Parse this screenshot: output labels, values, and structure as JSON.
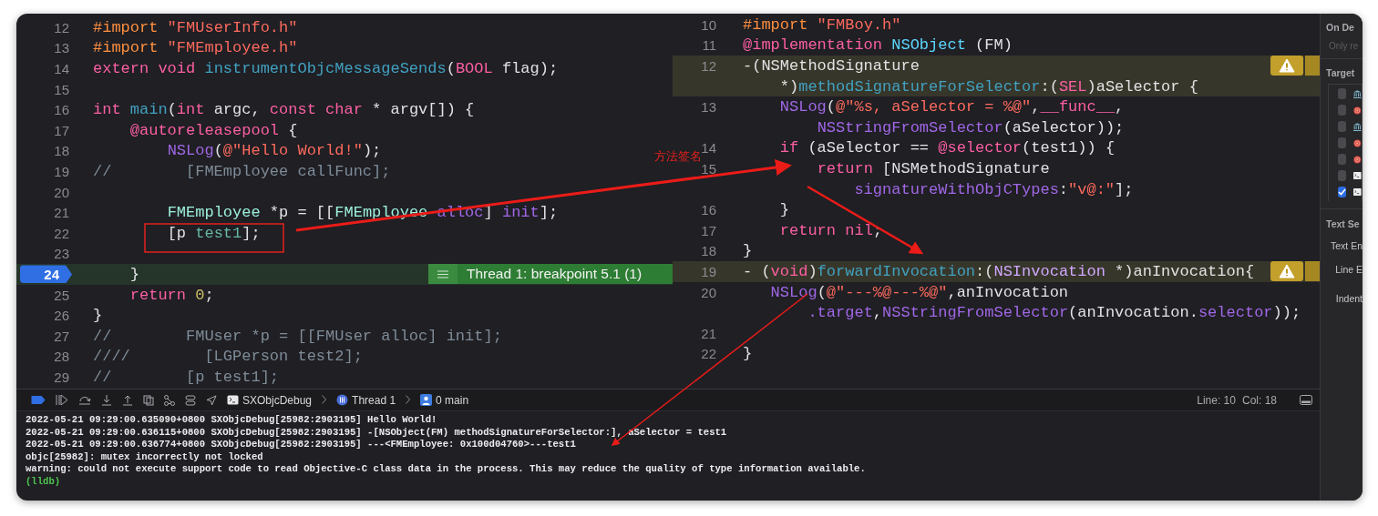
{
  "left_editor": {
    "breakpoint_banner": "Thread 1: breakpoint 5.1 (1)",
    "lines": [
      {
        "number": "12",
        "kind": "code",
        "rows": [
          {
            "tokens": [
              {
                "kind": "pre",
                "text": "#import"
              },
              {
                "kind": "str",
                "text": " \"FMUserInfo.h\""
              }
            ]
          }
        ]
      },
      {
        "number": "13",
        "kind": "code",
        "rows": [
          {
            "tokens": [
              {
                "kind": "pre",
                "text": "#import"
              },
              {
                "kind": "str",
                "text": " \"FMEmployee.h\""
              }
            ]
          }
        ]
      },
      {
        "number": "14",
        "kind": "code",
        "rows": [
          {
            "tokens": [
              {
                "kind": "kw",
                "text": "extern"
              },
              {
                "kind": "kw",
                "text": " void"
              },
              {
                "kind": "decl",
                "text": " instrumentObjcMessageSends"
              },
              {
                "kind": "tx",
                "text": "("
              },
              {
                "kind": "kw",
                "text": "BOOL"
              },
              {
                "kind": "tx",
                "text": " flag);"
              }
            ]
          }
        ]
      },
      {
        "number": "15",
        "kind": "code",
        "rows": [
          {
            "tokens": []
          }
        ]
      },
      {
        "number": "16",
        "kind": "code",
        "rows": [
          {
            "tokens": [
              {
                "kind": "kw",
                "text": "int"
              },
              {
                "kind": "decl",
                "text": " main"
              },
              {
                "kind": "tx",
                "text": "("
              },
              {
                "kind": "kw",
                "text": "int"
              },
              {
                "kind": "tx",
                "text": " argc, "
              },
              {
                "kind": "kw",
                "text": "const"
              },
              {
                "kind": "kw",
                "text": " char"
              },
              {
                "kind": "tx",
                "text": " * argv[]) {"
              }
            ]
          }
        ]
      },
      {
        "number": "17",
        "kind": "code",
        "rows": [
          {
            "tokens": [
              {
                "kind": "kw",
                "text": "    @autoreleasepool"
              },
              {
                "kind": "tx",
                "text": " {"
              }
            ]
          }
        ]
      },
      {
        "number": "18",
        "kind": "code",
        "rows": [
          {
            "tokens": [
              {
                "kind": "fn",
                "text": "        NSLog"
              },
              {
                "kind": "tx",
                "text": "("
              },
              {
                "kind": "str",
                "text": "@\"Hello World!\""
              },
              {
                "kind": "tx",
                "text": ");"
              }
            ]
          }
        ]
      },
      {
        "number": "19",
        "kind": "code",
        "rows": [
          {
            "tokens": [
              {
                "kind": "cm",
                "text": "//        [FMEmployee callFunc];"
              }
            ]
          }
        ]
      },
      {
        "number": "20",
        "kind": "code",
        "rows": [
          {
            "tokens": []
          }
        ]
      },
      {
        "number": "21",
        "kind": "code",
        "rows": [
          {
            "tokens": [
              {
                "kind": "cls",
                "text": "        FMEmployee"
              },
              {
                "kind": "tx",
                "text": " *p = [["
              },
              {
                "kind": "cls",
                "text": "FMEmployee"
              },
              {
                "kind": "fn",
                "text": " alloc"
              },
              {
                "kind": "tx",
                "text": "] "
              },
              {
                "kind": "fn",
                "text": "init"
              },
              {
                "kind": "tx",
                "text": "];"
              }
            ]
          }
        ]
      },
      {
        "number": "22",
        "kind": "code",
        "rows": [
          {
            "tokens": [
              {
                "kind": "tx",
                "text": "        [p "
              },
              {
                "kind": "proj",
                "text": "test1"
              },
              {
                "kind": "tx",
                "text": "];"
              }
            ]
          }
        ]
      },
      {
        "number": "23",
        "kind": "code",
        "rows": [
          {
            "tokens": []
          }
        ]
      },
      {
        "number": "24",
        "kind": "breakpoint",
        "rows": [
          {
            "tokens": [
              {
                "kind": "tx",
                "text": "    }"
              }
            ]
          }
        ]
      },
      {
        "number": "25",
        "kind": "code",
        "rows": [
          {
            "tokens": [
              {
                "kind": "kw",
                "text": "    return"
              },
              {
                "kind": "num",
                "text": " 0"
              },
              {
                "kind": "tx",
                "text": ";"
              }
            ]
          }
        ]
      },
      {
        "number": "26",
        "kind": "code",
        "rows": [
          {
            "tokens": [
              {
                "kind": "tx",
                "text": "}"
              }
            ]
          }
        ]
      },
      {
        "number": "27",
        "kind": "code",
        "rows": [
          {
            "tokens": [
              {
                "kind": "cm",
                "text": "//        FMUser *p = [[FMUser alloc] init];"
              }
            ]
          }
        ]
      },
      {
        "number": "28",
        "kind": "code",
        "rows": [
          {
            "tokens": [
              {
                "kind": "cm",
                "text": "////        [LGPerson test2];"
              }
            ]
          }
        ]
      },
      {
        "number": "29",
        "kind": "code",
        "rows": [
          {
            "tokens": [
              {
                "kind": "cm",
                "text": "//        [p test1];"
              }
            ]
          }
        ]
      }
    ]
  },
  "right_editor": {
    "lines": [
      {
        "number": "10",
        "kind": "code",
        "rows": [
          {
            "tokens": [
              {
                "kind": "pre",
                "text": "#import"
              },
              {
                "kind": "str",
                "text": " \"FMBoy.h\""
              }
            ]
          }
        ]
      },
      {
        "number": "11",
        "kind": "code",
        "rows": [
          {
            "tokens": [
              {
                "kind": "kw",
                "text": "@implementation"
              },
              {
                "kind": "sys",
                "text": " NSObject"
              },
              {
                "kind": "tx",
                "text": " (FM)"
              }
            ]
          }
        ]
      },
      {
        "number": "12",
        "kind": "warning",
        "rows": [
          {
            "tokens": [
              {
                "kind": "tx",
                "text": "-(NSMethodSignature"
              }
            ]
          },
          {
            "tokens": [
              {
                "kind": "tx",
                "text": "    *)"
              },
              {
                "kind": "decl",
                "text": "methodSignatureForSelector"
              },
              {
                "kind": "tx",
                "text": ":("
              },
              {
                "kind": "kw",
                "text": "SEL"
              },
              {
                "kind": "tx",
                "text": ")aSelector {"
              }
            ]
          }
        ]
      },
      {
        "number": "13",
        "kind": "code",
        "rows": [
          {
            "tokens": [
              {
                "kind": "fn",
                "text": "    NSLog"
              },
              {
                "kind": "tx",
                "text": "("
              },
              {
                "kind": "str",
                "text": "@\"%s, aSelector = %@\""
              },
              {
                "kind": "tx",
                "text": ","
              },
              {
                "kind": "kw",
                "text": "__func__"
              },
              {
                "kind": "tx",
                "text": ","
              }
            ]
          },
          {
            "tokens": [
              {
                "kind": "fn",
                "text": "        NSStringFromSelector"
              },
              {
                "kind": "tx",
                "text": "(aSelector));"
              }
            ]
          }
        ]
      },
      {
        "number": "14",
        "kind": "code",
        "rows": [
          {
            "tokens": [
              {
                "kind": "kw",
                "text": "    if"
              },
              {
                "kind": "tx",
                "text": " (aSelector == "
              },
              {
                "kind": "kw",
                "text": "@selector"
              },
              {
                "kind": "tx",
                "text": "(test1)) {"
              }
            ]
          }
        ]
      },
      {
        "number": "15",
        "kind": "code",
        "rows": [
          {
            "tokens": [
              {
                "kind": "kw",
                "text": "        return"
              },
              {
                "kind": "tx",
                "text": " [NSMethodSignature"
              }
            ]
          },
          {
            "tokens": [
              {
                "kind": "fn",
                "text": "            signatureWithObjCTypes"
              },
              {
                "kind": "tx",
                "text": ":"
              },
              {
                "kind": "str",
                "text": "\"v@:\""
              },
              {
                "kind": "tx",
                "text": "];"
              }
            ]
          }
        ]
      },
      {
        "number": "16",
        "kind": "code",
        "rows": [
          {
            "tokens": [
              {
                "kind": "tx",
                "text": "    }"
              }
            ]
          }
        ]
      },
      {
        "number": "17",
        "kind": "code",
        "rows": [
          {
            "tokens": [
              {
                "kind": "kw",
                "text": "    return"
              },
              {
                "kind": "kw",
                "text": " nil"
              },
              {
                "kind": "tx",
                "text": ";"
              }
            ]
          }
        ]
      },
      {
        "number": "18",
        "kind": "code",
        "rows": [
          {
            "tokens": [
              {
                "kind": "tx",
                "text": "}"
              }
            ]
          }
        ]
      },
      {
        "number": "19",
        "kind": "warning",
        "rows": [
          {
            "tokens": [
              {
                "kind": "tx",
                "text": "- ("
              },
              {
                "kind": "kw",
                "text": "void"
              },
              {
                "kind": "tx",
                "text": ")"
              },
              {
                "kind": "decl",
                "text": "forwardInvocation"
              },
              {
                "kind": "tx",
                "text": ":("
              },
              {
                "kind": "typ",
                "text": "NSInvocation"
              },
              {
                "kind": "tx",
                "text": " *)anInvocation{"
              }
            ]
          }
        ]
      },
      {
        "number": "20",
        "kind": "code",
        "rows": [
          {
            "tokens": [
              {
                "kind": "fn",
                "text": "   NSLog"
              },
              {
                "kind": "tx",
                "text": "("
              },
              {
                "kind": "str",
                "text": "@\"---%@---%@\""
              },
              {
                "kind": "tx",
                "text": ",anInvocation"
              }
            ]
          },
          {
            "tokens": [
              {
                "kind": "fn",
                "text": "       .target"
              },
              {
                "kind": "tx",
                "text": ","
              },
              {
                "kind": "fn",
                "text": "NSStringFromSelector"
              },
              {
                "kind": "tx",
                "text": "(anInvocation."
              },
              {
                "kind": "fn",
                "text": "selector"
              },
              {
                "kind": "tx",
                "text": "));"
              }
            ]
          }
        ]
      },
      {
        "number": "21",
        "kind": "code",
        "rows": [
          {
            "tokens": []
          }
        ]
      },
      {
        "number": "22",
        "kind": "code",
        "rows": [
          {
            "tokens": [
              {
                "kind": "tx",
                "text": "}"
              }
            ]
          }
        ]
      }
    ]
  },
  "annotation_label": "方法签名",
  "debug_bar": {
    "breakpoints_active": true,
    "breadcrumbs": [
      {
        "kind": "app",
        "text": "SXObjcDebug"
      },
      {
        "kind": "thread",
        "text": "Thread 1"
      },
      {
        "kind": "frame",
        "text": "0 main"
      }
    ],
    "line": "Line: 10",
    "column": "Col: 18"
  },
  "console": {
    "lines": [
      {
        "kind": "output",
        "text": "2022-05-21 09:29:00.635090+0800 SXObjcDebug[25982:2903195] Hello World!"
      },
      {
        "kind": "output",
        "text": "2022-05-21 09:29:00.636115+0800 SXObjcDebug[25982:2903195] -[NSObject(FM) methodSignatureForSelector:], aSelector = test1"
      },
      {
        "kind": "output",
        "text": "2022-05-21 09:29:00.636774+0800 SXObjcDebug[25982:2903195] ---<FMEmployee: 0x100d04760>---test1"
      },
      {
        "kind": "output",
        "text": "objc[25982]: mutex incorrectly not locked"
      },
      {
        "kind": "output",
        "text": "warning: could not execute support code to read Objective-C class data in the process. This may reduce the quality of type information available."
      },
      {
        "kind": "prompt",
        "text": "(lldb)"
      }
    ]
  },
  "inspector": {
    "on_demand_title": "On De",
    "on_demand_hint": "Only re",
    "target_title": "Target",
    "targets": [
      {
        "kind": "library",
        "checked": false
      },
      {
        "kind": "target",
        "checked": false
      },
      {
        "kind": "library",
        "checked": false
      },
      {
        "kind": "target",
        "checked": false
      },
      {
        "kind": "target",
        "checked": false
      },
      {
        "kind": "tool",
        "checked": false
      },
      {
        "kind": "tool",
        "checked": true
      }
    ],
    "text_settings_title": "Text Se",
    "fields": [
      "Text En",
      "Line E",
      "Indent"
    ]
  }
}
